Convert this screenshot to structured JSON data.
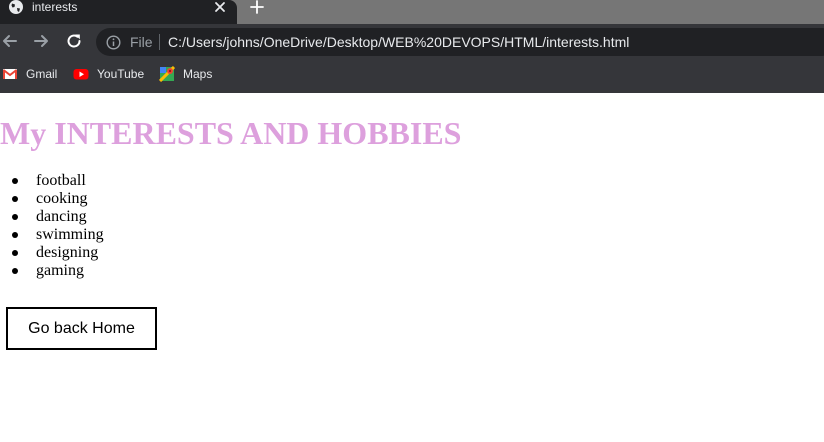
{
  "browser": {
    "tab": {
      "title": "interests"
    },
    "address_bar": {
      "scheme_label": "File",
      "url": "C:/Users/johns/OneDrive/Desktop/WEB%20DEVOPS/HTML/interests.html"
    },
    "bookmarks": [
      {
        "label": "Gmail",
        "icon": "gmail-icon"
      },
      {
        "label": "YouTube",
        "icon": "youtube-icon"
      },
      {
        "label": "Maps",
        "icon": "maps-icon"
      }
    ]
  },
  "page": {
    "heading": "My INTERESTS AND HOBBIES",
    "heading_color": "#dda0dd",
    "hobbies": [
      "football",
      "cooking",
      "dancing",
      "swimming",
      "designing",
      "gaming"
    ],
    "home_button_label": "Go back Home"
  }
}
